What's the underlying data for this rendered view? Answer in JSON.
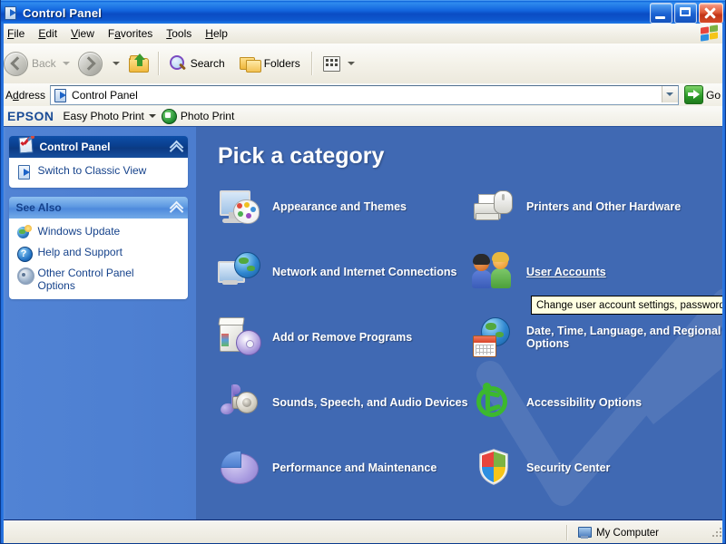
{
  "window": {
    "title": "Control Panel",
    "icon": "control-panel-icon",
    "minimize_label": "Minimize",
    "maximize_label": "Maximize",
    "close_label": "Close"
  },
  "menu": {
    "items": [
      {
        "label": "File",
        "accel": "F"
      },
      {
        "label": "Edit",
        "accel": "E"
      },
      {
        "label": "View",
        "accel": "V"
      },
      {
        "label": "Favorites",
        "accel": "a"
      },
      {
        "label": "Tools",
        "accel": "T"
      },
      {
        "label": "Help",
        "accel": "H"
      }
    ],
    "logo": "windows-flag-icon"
  },
  "toolbar": {
    "back_label": "Back",
    "forward_label": "Forward",
    "up_label": "Up One Level",
    "search_label": "Search",
    "folders_label": "Folders",
    "views_label": "Views"
  },
  "address": {
    "label": "Address",
    "value": "Control Panel",
    "go_label": "Go"
  },
  "epson": {
    "logo": "EPSON",
    "easy_photo_print": "Easy Photo Print",
    "photo_print": "Photo Print"
  },
  "sidebar": {
    "panels": [
      {
        "title": "Control Panel",
        "style": "dark",
        "items": [
          {
            "label": "Switch to Classic View",
            "icon": "switch-view-icon"
          }
        ]
      },
      {
        "title": "See Also",
        "style": "light",
        "items": [
          {
            "label": "Windows Update",
            "icon": "windows-update-icon"
          },
          {
            "label": "Help and Support",
            "icon": "help-support-icon"
          },
          {
            "label": "Other Control Panel\nOptions",
            "icon": "gear-icon"
          }
        ]
      }
    ]
  },
  "main": {
    "title": "Pick a category",
    "categories": [
      {
        "label": "Appearance and Themes",
        "icon": "appearance-themes-icon",
        "hover": false
      },
      {
        "label": "Printers and Other Hardware",
        "icon": "printers-hardware-icon",
        "hover": false
      },
      {
        "label": "Network and Internet Connections",
        "icon": "network-internet-icon",
        "hover": false
      },
      {
        "label": "User Accounts",
        "icon": "user-accounts-icon",
        "hover": true
      },
      {
        "label": "Add or Remove Programs",
        "icon": "add-remove-programs-icon",
        "hover": false
      },
      {
        "label": "Date, Time, Language, and Regional Options",
        "icon": "date-time-language-icon",
        "hover": false
      },
      {
        "label": "Sounds, Speech, and Audio Devices",
        "icon": "sounds-speech-audio-icon",
        "hover": false
      },
      {
        "label": "Accessibility Options",
        "icon": "accessibility-options-icon",
        "hover": false
      },
      {
        "label": "Performance and Maintenance",
        "icon": "performance-maintenance-icon",
        "hover": false
      },
      {
        "label": "Security Center",
        "icon": "security-center-icon",
        "hover": false
      }
    ]
  },
  "tooltip": {
    "text": "Change user account settings, passwords, a",
    "background": "#FFFFE1"
  },
  "statusbar": {
    "text": "My Computer",
    "icon": "my-computer-icon"
  },
  "colors": {
    "titlebar": "#1366DE",
    "main_background": "#4069B3",
    "sidebar_background": "#5183D4",
    "panel_header_dark": "#0A3F8E",
    "panel_header_light": "#5E99E2",
    "link_text": "#15428B",
    "close_button": "#C23316"
  }
}
